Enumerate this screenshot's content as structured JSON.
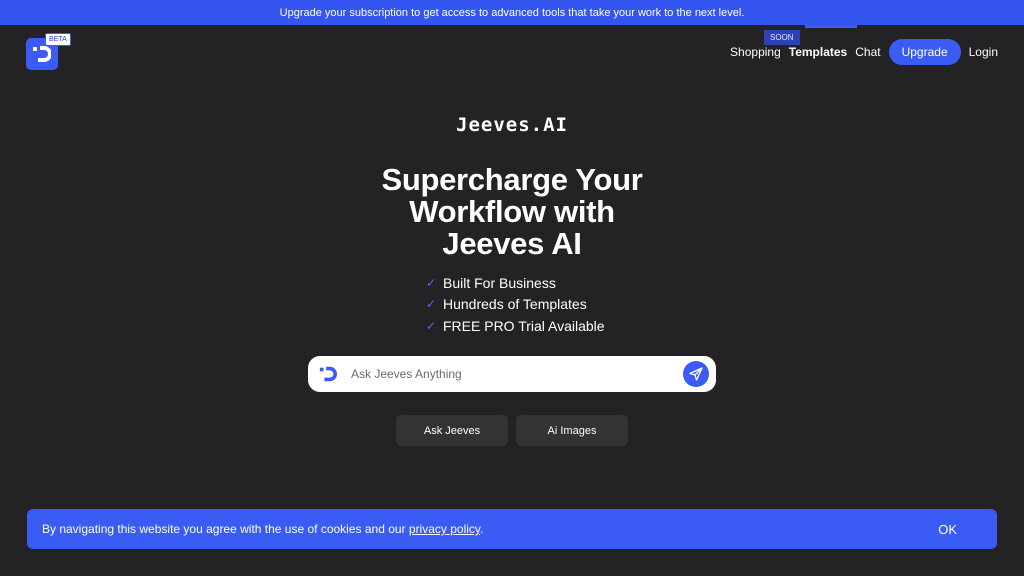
{
  "promo": {
    "text": "Upgrade your subscription to get access to advanced tools that take your work to the next level."
  },
  "header": {
    "beta_label": "BETA",
    "soon_label": "SOON",
    "nav": {
      "shopping": "Shopping",
      "templates": "Templates",
      "chat": "Chat",
      "upgrade": "Upgrade",
      "login": "Login"
    }
  },
  "hero": {
    "brand": "Jeeves.AI",
    "title_line1": "Supercharge Your",
    "title_line2": "Workflow with",
    "title_line3": "Jeeves AI",
    "features": [
      "Built For Business",
      "Hundreds of Templates",
      "FREE PRO Trial Available"
    ]
  },
  "search": {
    "placeholder": "Ask Jeeves Anything",
    "value": ""
  },
  "actions": {
    "ask": "Ask Jeeves",
    "images": "Ai Images"
  },
  "cookie": {
    "text": "By navigating this website you agree with the use of cookies and our ",
    "link": "privacy policy",
    "suffix": ".",
    "ok": "OK"
  },
  "icons": {
    "logo": "jeeves-logo-icon",
    "check": "check-icon",
    "send": "send-icon"
  },
  "colors": {
    "background": "#232325",
    "accent": "#3a5cf5",
    "promo": "#3555f0",
    "button_dark": "#333336"
  }
}
